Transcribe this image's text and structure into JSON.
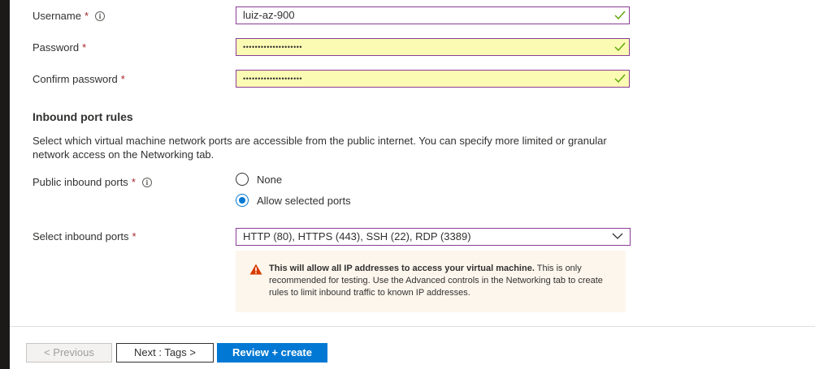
{
  "form": {
    "username": {
      "label": "Username",
      "required_mark": "*",
      "info_icon": "info-icon",
      "value": "luiz-az-900"
    },
    "password": {
      "label": "Password",
      "required_mark": "*",
      "value": "••••••••••••••••••••"
    },
    "confirm_password": {
      "label": "Confirm password",
      "required_mark": "*",
      "value": "••••••••••••••••••••"
    }
  },
  "inbound": {
    "title": "Inbound port rules",
    "description": "Select which virtual machine network ports are accessible from the public internet. You can specify more limited or granular network access on the Networking tab.",
    "public_ports": {
      "label": "Public inbound ports",
      "required_mark": "*",
      "options": [
        {
          "label": "None",
          "selected": false
        },
        {
          "label": "Allow selected ports",
          "selected": true
        }
      ]
    },
    "select_ports": {
      "label": "Select inbound ports",
      "required_mark": "*",
      "value": "HTTP (80), HTTPS (443), SSH (22), RDP (3389)"
    },
    "warning": {
      "bold": "This will allow all IP addresses to access your virtual machine.",
      "text": " This is only recommended for testing.  Use the Advanced controls in the Networking tab to create rules to limit inbound traffic to known IP addresses."
    }
  },
  "footer": {
    "previous_label": "< Previous",
    "next_label": "Next : Tags >",
    "review_label": "Review + create"
  },
  "colors": {
    "accent": "#0078d4",
    "focus_border": "#8a3d96",
    "valid_check": "#57a300",
    "required": "#a4262c",
    "warning_bg": "#fdf6ed",
    "warning_icon": "#d83b01"
  }
}
